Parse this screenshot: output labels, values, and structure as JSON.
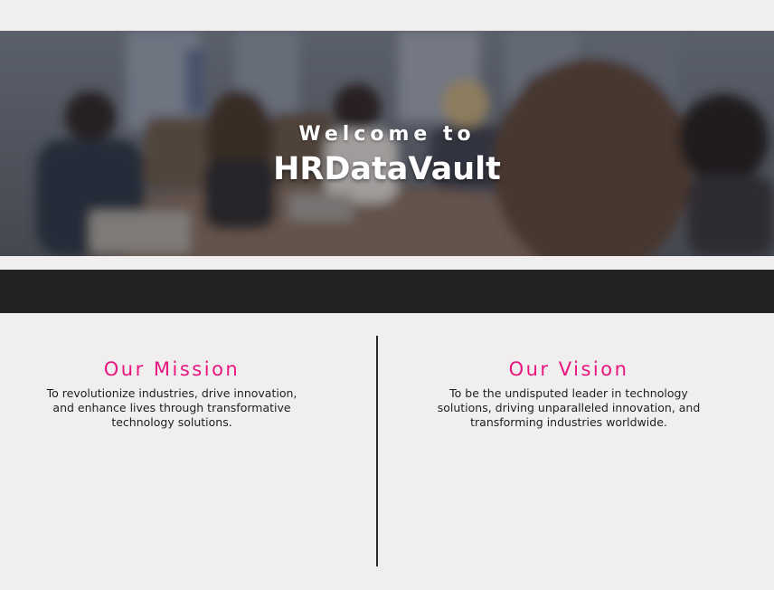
{
  "hero": {
    "welcome": "Welcome to",
    "title": "HRDataVault",
    "background_image": "blurred-team-meeting-photo"
  },
  "mission": {
    "heading": "Our Mission",
    "text": "To revolutionize industries, drive innovation, and enhance lives through transformative technology solutions."
  },
  "vision": {
    "heading": "Our Vision",
    "text": "To be the undisputed leader in technology solutions, driving unparalleled innovation, and transforming industries worldwide."
  },
  "colors": {
    "page_background": "#f0eeef",
    "accent": "#e8157f",
    "dark_strip": "#232122",
    "divider": "#2b2b2b"
  }
}
